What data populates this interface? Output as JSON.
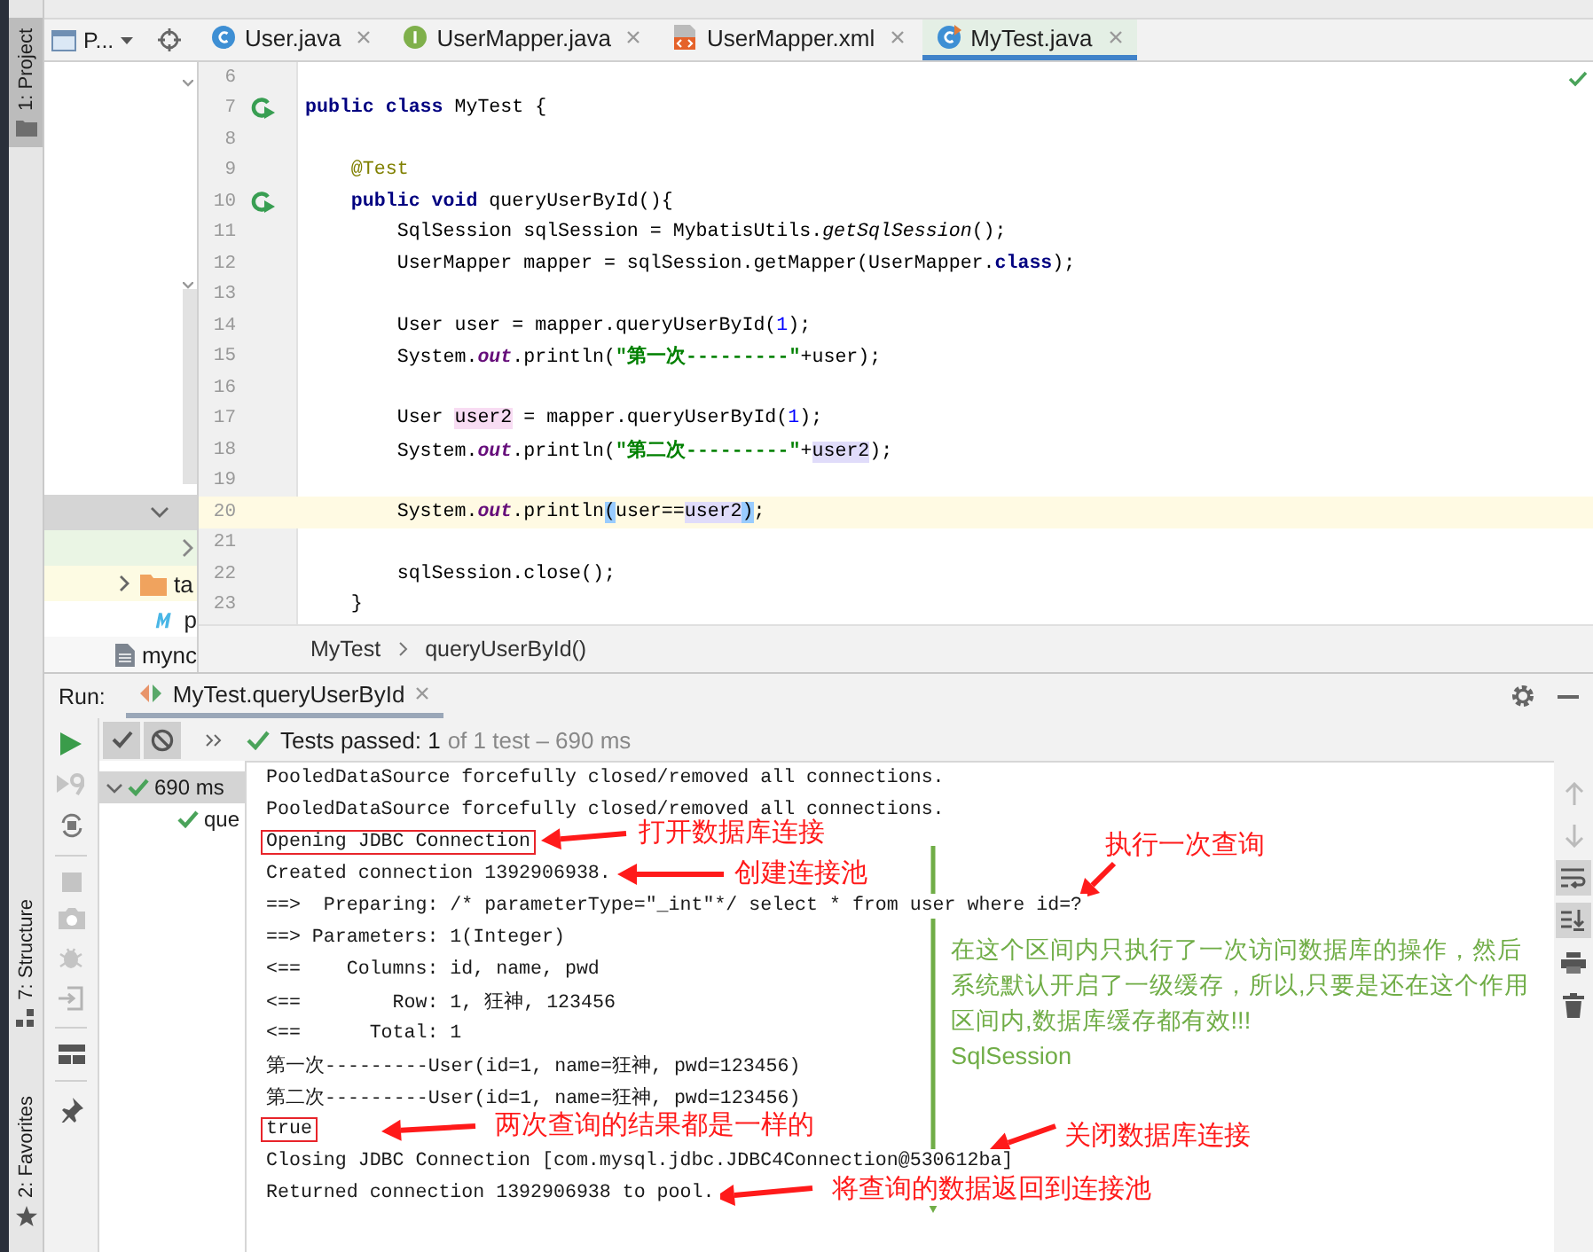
{
  "tool_windows": [
    {
      "kind": "project",
      "label": "1: Project",
      "selected": true
    },
    {
      "kind": "structure",
      "label": "7: Structure",
      "selected": false
    },
    {
      "kind": "favorites",
      "label": "2: Favorites",
      "selected": false
    }
  ],
  "project_panel": {
    "title": "P...",
    "items": [
      {
        "kind": "folder",
        "label": "ta",
        "expanded": false
      },
      {
        "kind": "maven",
        "label": "p"
      },
      {
        "kind": "file",
        "label": "mync"
      }
    ]
  },
  "editor_tabs": [
    {
      "kind": "class",
      "label": "User.java",
      "selected": false
    },
    {
      "kind": "interface",
      "label": "UserMapper.java",
      "selected": false
    },
    {
      "kind": "xml",
      "label": "UserMapper.xml",
      "selected": false
    },
    {
      "kind": "test",
      "label": "MyTest.java",
      "selected": true
    }
  ],
  "editor": {
    "lines": [
      {
        "number": "6",
        "current": false,
        "run_marker": false
      },
      {
        "number": "7",
        "current": false,
        "run_marker": true,
        "tokens": [
          {
            "kind": "kw",
            "text": "public class "
          },
          {
            "kind": "plain",
            "text": "MyTest {"
          }
        ]
      },
      {
        "number": "8",
        "current": false,
        "run_marker": false
      },
      {
        "number": "9",
        "current": false,
        "run_marker": false,
        "tokens": [
          {
            "kind": "annotation",
            "text": "    @Test"
          }
        ]
      },
      {
        "number": "10",
        "current": false,
        "run_marker": true,
        "tokens": [
          {
            "kind": "kw",
            "text": "    public void "
          },
          {
            "kind": "plain",
            "text": "queryUserById(){"
          }
        ]
      },
      {
        "number": "11",
        "current": false,
        "run_marker": false,
        "tokens": [
          {
            "kind": "plain",
            "text": "        SqlSession sqlSession = MybatisUtils."
          },
          {
            "kind": "italic",
            "text": "getSqlSession"
          },
          {
            "kind": "plain",
            "text": "();"
          }
        ]
      },
      {
        "number": "12",
        "current": false,
        "run_marker": false,
        "tokens": [
          {
            "kind": "plain",
            "text": "        UserMapper mapper = sqlSession.getMapper(UserMapper."
          },
          {
            "kind": "kw",
            "text": "class"
          },
          {
            "kind": "plain",
            "text": ");"
          }
        ]
      },
      {
        "number": "13",
        "current": false,
        "run_marker": false
      },
      {
        "number": "14",
        "current": false,
        "run_marker": false,
        "tokens": [
          {
            "kind": "plain",
            "text": "        User user = mapper.queryUserById("
          },
          {
            "kind": "number",
            "text": "1"
          },
          {
            "kind": "plain",
            "text": ");"
          }
        ]
      },
      {
        "number": "15",
        "current": false,
        "run_marker": false,
        "tokens": [
          {
            "kind": "plain",
            "text": "        System."
          },
          {
            "kind": "field",
            "text": "out"
          },
          {
            "kind": "plain",
            "text": ".println("
          },
          {
            "kind": "string",
            "text": "\"第一次---------\""
          },
          {
            "kind": "plain",
            "text": "+user);"
          }
        ]
      },
      {
        "number": "16",
        "current": false,
        "run_marker": false
      },
      {
        "number": "17",
        "current": false,
        "run_marker": false,
        "tokens": [
          {
            "kind": "plain",
            "text": "        User "
          },
          {
            "kind": "write_usage",
            "text": "user2"
          },
          {
            "kind": "plain",
            "text": " = mapper.queryUserById("
          },
          {
            "kind": "number",
            "text": "1"
          },
          {
            "kind": "plain",
            "text": ");"
          }
        ]
      },
      {
        "number": "18",
        "current": false,
        "run_marker": false,
        "tokens": [
          {
            "kind": "plain",
            "text": "        System."
          },
          {
            "kind": "field",
            "text": "out"
          },
          {
            "kind": "plain",
            "text": ".println("
          },
          {
            "kind": "string",
            "text": "\"第二次---------\""
          },
          {
            "kind": "plain",
            "text": "+"
          },
          {
            "kind": "read_usage",
            "text": "user2"
          },
          {
            "kind": "plain",
            "text": ");"
          }
        ]
      },
      {
        "number": "19",
        "current": false,
        "run_marker": false
      },
      {
        "number": "20",
        "current": true,
        "run_marker": false,
        "tokens": [
          {
            "kind": "plain",
            "text": "        System."
          },
          {
            "kind": "field",
            "text": "out"
          },
          {
            "kind": "plain",
            "text": ".println"
          },
          {
            "kind": "brace",
            "text": "("
          },
          {
            "kind": "plain",
            "text": "user=="
          },
          {
            "kind": "read_usage",
            "text": "user2"
          },
          {
            "kind": "brace",
            "text": ")"
          },
          {
            "kind": "plain",
            "text": ";"
          }
        ]
      },
      {
        "number": "21",
        "current": false,
        "run_marker": false
      },
      {
        "number": "22",
        "current": false,
        "run_marker": false,
        "tokens": [
          {
            "kind": "plain",
            "text": "        sqlSession.close();"
          }
        ]
      },
      {
        "number": "23",
        "current": false,
        "run_marker": false,
        "tokens": [
          {
            "kind": "plain",
            "text": "    }"
          }
        ]
      }
    ]
  },
  "breadcrumb": [
    "MyTest",
    "queryUserById()"
  ],
  "run": {
    "label": "Run:",
    "tab": "MyTest.queryUserById",
    "status": {
      "passed": "Tests passed: 1",
      "detail": "of 1 test – 690 ms"
    },
    "tree": [
      {
        "label": "690 ms",
        "selected": true,
        "expanded": true,
        "children": [
          {
            "label": "que",
            "selected": false
          }
        ]
      }
    ],
    "console_tools": [
      {
        "kind": "up",
        "on": false
      },
      {
        "kind": "down",
        "on": false
      },
      {
        "kind": "wrap",
        "on": true
      },
      {
        "kind": "scroll_end",
        "on": true
      },
      {
        "kind": "print",
        "on": false
      },
      {
        "kind": "delete",
        "on": false
      }
    ],
    "console": [
      {
        "text": "PooledDataSource forcefully closed/removed all connections."
      },
      {
        "text": "PooledDataSource forcefully closed/removed all connections."
      },
      {
        "text": "Opening JDBC Connection",
        "boxed": true
      },
      {
        "text": "Created connection 1392906938."
      },
      {
        "text": "==>  Preparing: /* parameterType=\"_int\"*/ select * from user where id=?"
      },
      {
        "text": "==> Parameters: 1(Integer)"
      },
      {
        "text": "<==    Columns: id, name, pwd"
      },
      {
        "text": "<==        Row: 1, 狂神, 123456"
      },
      {
        "text": "<==      Total: 1"
      },
      {
        "text": "第一次---------User(id=1, name=狂神, pwd=123456)"
      },
      {
        "text": "第二次---------User(id=1, name=狂神, pwd=123456)"
      },
      {
        "text": "true",
        "boxed": true
      },
      {
        "text": "Closing JDBC Connection [com.mysql.jdbc.JDBC4Connection@530612ba]"
      },
      {
        "text": "Returned connection 1392906938 to pool."
      }
    ],
    "annotations": [
      {
        "kind": "note",
        "text": "打开数据库连接",
        "color": "#ff1a1a"
      },
      {
        "kind": "note",
        "text": "创建连接池",
        "color": "#ff1a1a"
      },
      {
        "kind": "note",
        "text": "执行一次查询",
        "color": "#ff1a1a"
      },
      {
        "kind": "scope",
        "lines": [
          "在这个区间内只执行了一次访问数据库的操作，然后",
          "系统默认开启了一级缓存，所以,只要是还在这个作用",
          "区间内,数据库缓存都有效!!!",
          "SqlSession"
        ],
        "color": "#70ad47"
      },
      {
        "kind": "note",
        "text": "两次查询的结果都是一样的",
        "color": "#ff1a1a"
      },
      {
        "kind": "note",
        "text": "关闭数据库连接",
        "color": "#ff1a1a"
      },
      {
        "kind": "note",
        "text": "将查询的数据返回到连接池",
        "color": "#ff1a1a"
      }
    ]
  }
}
